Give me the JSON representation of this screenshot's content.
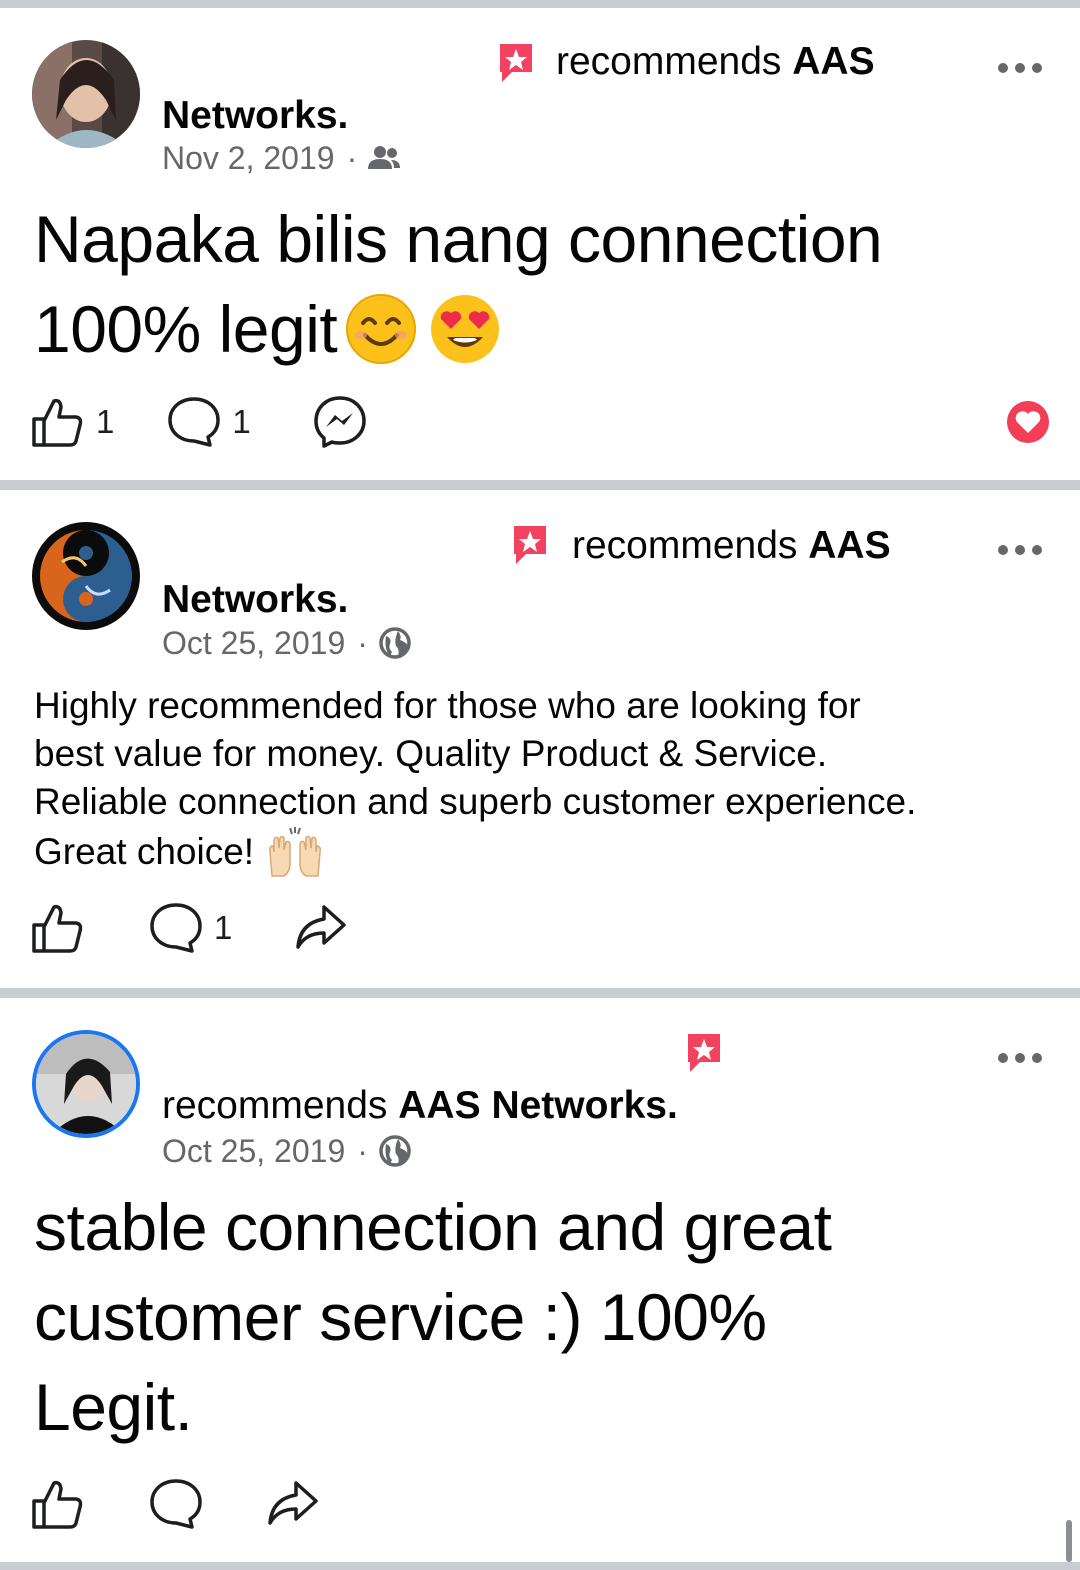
{
  "posts": [
    {
      "recommends_prefix": "recommends",
      "page_name_part1": "AAS",
      "page_name_part2": "Networks.",
      "date": "Nov 2, 2019",
      "audience_icon": "friends-icon",
      "text_line1": "Napaka bilis nang connection",
      "text_line2": "100% legit",
      "emojis": [
        "smiling-face-icon",
        "heart-eyes-icon"
      ],
      "like_count": "1",
      "comment_count": "1",
      "extra_action_icon": "messenger-icon",
      "reaction_icon": "love-reaction-icon"
    },
    {
      "recommends_prefix": "recommends",
      "page_name_part1": "AAS",
      "page_name_part2": "Networks.",
      "date": "Oct 25, 2019",
      "audience_icon": "globe-icon",
      "text_line1": "Highly recommended for those who are looking for",
      "text_line2": "best value for money. Quality Product & Service.",
      "text_line3": "Reliable connection and superb customer experience.",
      "text_line4": "Great choice!",
      "emojis": [
        "raising-hands-icon"
      ],
      "comment_count": "1",
      "extra_action_icon": "share-icon"
    },
    {
      "recommends_prefix": "recommends",
      "page_name": "AAS Networks.",
      "date": "Oct 25, 2019",
      "audience_icon": "globe-icon",
      "text_line1": "stable connection and great",
      "text_line2": "customer service :) 100%",
      "text_line3": "Legit.",
      "extra_action_icon": "share-icon"
    }
  ],
  "colors": {
    "separator": "#c9ccd0",
    "recommend_badge": "#f3425f",
    "secondary_text": "#65676b",
    "story_ring": "#1877f2"
  }
}
